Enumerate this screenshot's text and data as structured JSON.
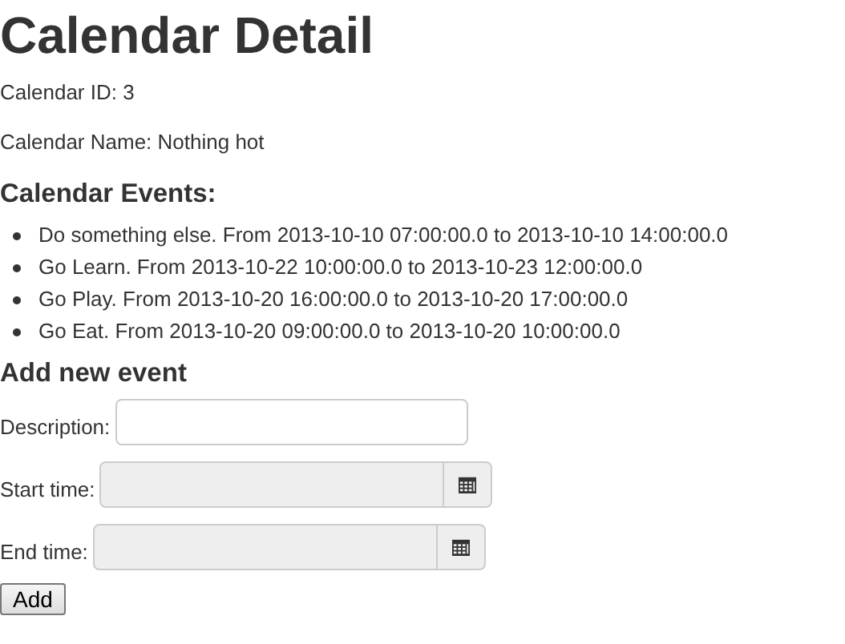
{
  "title": "Calendar Detail",
  "calendar_id": "Calendar ID: 3",
  "calendar_name": "Calendar Name: Nothing hot",
  "events_heading": "Calendar Events:",
  "events": [
    "Do something else. From 2013-10-10 07:00:00.0 to 2013-10-10 14:00:00.0",
    "Go Learn. From 2013-10-22 10:00:00.0 to 2013-10-23 12:00:00.0",
    "Go Play. From 2013-10-20 16:00:00.0 to 2013-10-20 17:00:00.0",
    "Go Eat. From 2013-10-20 09:00:00.0 to 2013-10-20 10:00:00.0"
  ],
  "form_heading": "Add new event",
  "fields": [
    {
      "label": "Description:",
      "kind": "text",
      "readonly": false
    },
    {
      "label": "Start time:",
      "kind": "datetime",
      "readonly": true
    },
    {
      "label": "End time:",
      "kind": "datetime",
      "readonly": true
    }
  ],
  "submit": "Add"
}
